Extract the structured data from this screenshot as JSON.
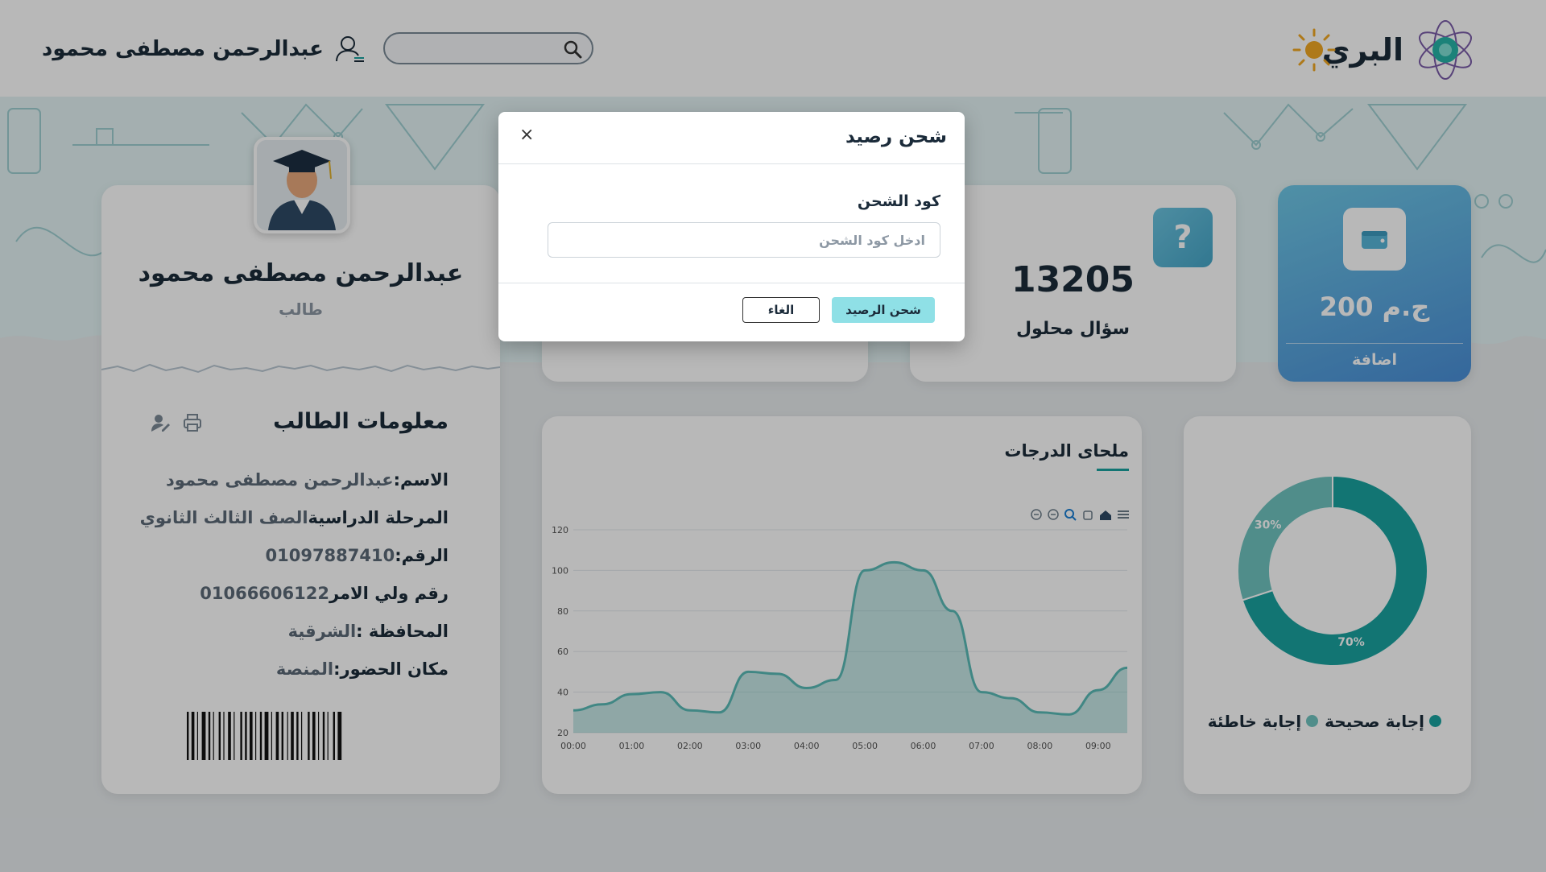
{
  "header": {
    "brand_name": "البري",
    "user_name": "عبدالرحمن مصطفى محمود",
    "search_placeholder": ""
  },
  "profile": {
    "name": "عبدالرحمن مصطفى محمود",
    "role": "طالب",
    "info_title": "معلومات الطالب",
    "rows": [
      {
        "label": "الاسم:",
        "value": "عبدالرحمن مصطفى محمود"
      },
      {
        "label": "المرحلة الدراسية",
        "value": "الصف الثالث الثانوي"
      },
      {
        "label": "الرقم:",
        "value": "01097887410"
      },
      {
        "label": "رقم ولي الامر",
        "value": "01066606122"
      },
      {
        "label": "المحافظة :",
        "value": "الشرقية"
      },
      {
        "label": "مكان الحضور:",
        "value": "المنصة"
      }
    ]
  },
  "stats": {
    "solved_value": "13205",
    "solved_label": "سؤال محلول",
    "question_badge": "?"
  },
  "wallet": {
    "amount": "200 ج.م",
    "add_label": "اضافة"
  },
  "grades": {
    "title": "ملحاى الدرجات"
  },
  "chart_data": [
    {
      "type": "area",
      "title": "ملحاى الدرجات",
      "x": [
        "00:00",
        "00:30",
        "01:00",
        "01:30",
        "02:00",
        "02:30",
        "03:00",
        "03:30",
        "04:00",
        "04:30",
        "05:00",
        "05:30",
        "06:00",
        "06:30",
        "07:00",
        "07:30",
        "08:00",
        "08:30",
        "09:00",
        "09:30"
      ],
      "values": [
        31,
        34,
        39,
        40,
        31,
        30,
        50,
        49,
        42,
        46,
        100,
        104,
        100,
        80,
        40,
        37,
        30,
        29,
        41,
        52
      ],
      "ylim": [
        20,
        120
      ],
      "yticks": [
        20,
        40,
        60,
        80,
        100,
        120
      ],
      "xticks": [
        "00:00",
        "01:00",
        "02:00",
        "03:00",
        "04:00",
        "05:00",
        "06:00",
        "07:00",
        "08:00",
        "09:00"
      ],
      "color": "#5bbcb8",
      "grid": true
    },
    {
      "type": "pie",
      "donut": true,
      "categories": [
        "إجابة صحيحة",
        "إجابة خاطئة"
      ],
      "values": [
        70,
        30
      ],
      "labels": [
        "70%",
        "30%"
      ],
      "colors": [
        "#1aa3a0",
        "#6fc4c0"
      ],
      "legend_position": "bottom"
    }
  ],
  "modal": {
    "title": "شحن رصيد",
    "close": "×",
    "field_label": "كود الشحن",
    "field_placeholder": "ادخل كود الشحن",
    "charge_button": "شحن الرصيد",
    "cancel_button": "الغاء"
  },
  "colors": {
    "accent": "#1aa3a0",
    "accent_light": "#8fe0e6",
    "wallet_top": "#6fc8e6",
    "wallet_bottom": "#4a8fd8"
  }
}
